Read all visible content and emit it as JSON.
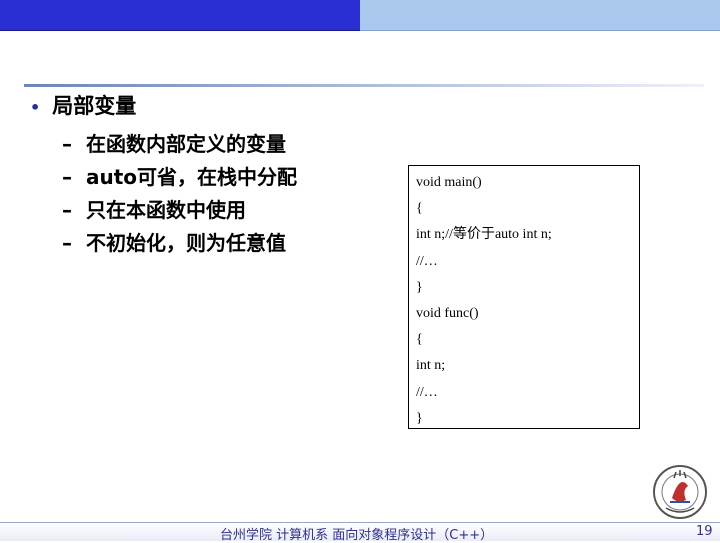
{
  "slide": {
    "heading": "局部变量",
    "bullet_glyph": "•",
    "dash_glyph": "–",
    "items": [
      "在函数内部定义的变量",
      "auto可省，在栈中分配",
      "只在本函数中使用",
      "不初始化，则为任意值"
    ],
    "code": [
      "void main()",
      "{",
      "int n;//等价于auto int n;",
      "//…",
      "}",
      "void func()",
      "{",
      "int n;",
      "//…",
      "}"
    ],
    "logo_icon": "university-seal-icon"
  },
  "footer": {
    "text": "台州学院 计算机系 面向对象程序设计（C++）",
    "page_number": "19"
  },
  "colors": {
    "topbar_left": "#2a2fd3",
    "topbar_right": "#aac8ee",
    "bullet": "#1f2ea8",
    "footer_text": "#2f2f8f"
  }
}
